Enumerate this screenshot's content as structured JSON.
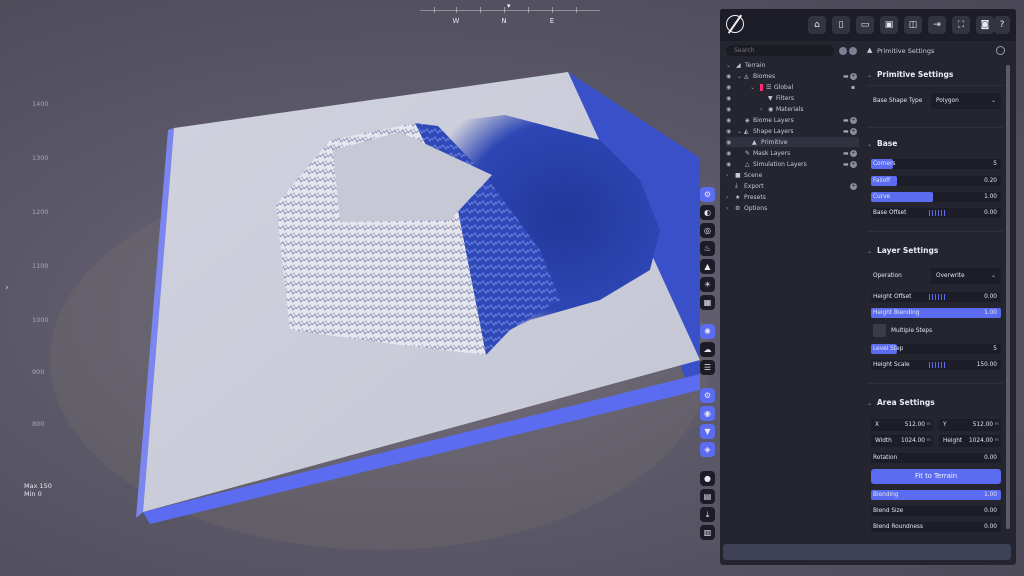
{
  "viewport": {
    "compass": [
      "W",
      "N",
      "E"
    ],
    "height_scale": [
      "1400",
      "1300",
      "1200",
      "1100",
      "1000",
      "900",
      "800"
    ],
    "height_readout": {
      "max": "Max 150",
      "min": "Min 0"
    },
    "tool_groups": [
      [
        "gear-icon",
        "circle-half-icon",
        "target-icon",
        "fire-icon",
        "triangle-icon",
        "sunrise-icon",
        "grid-icon"
      ],
      [
        "sparkle-icon",
        "cloud-icon",
        "lines-icon"
      ],
      [
        "settings-plus-icon",
        "eye-icon",
        "filter-icon",
        "layers-icon"
      ],
      [
        "record-icon",
        "folder-icon",
        "download-icon",
        "chart-icon"
      ]
    ],
    "colors": {
      "terrain_top": "#c9cbd8",
      "terrain_edge": "#5b6cf0",
      "shadow": "#2d42a8",
      "sky": "#5b5868"
    }
  },
  "toolbar": {
    "buttons": [
      "home-icon",
      "new-file-icon",
      "open-folder-icon",
      "save-icon",
      "save-as-icon",
      "export-icon",
      "fullscreen-icon",
      "camera-icon",
      "help-icon"
    ]
  },
  "tree": {
    "search_placeholder": "Search",
    "items": [
      {
        "label": "Terrain",
        "icon": "◢"
      },
      {
        "label": "Biomes",
        "icon": "◬"
      },
      {
        "label": "Global",
        "icon": "☰"
      },
      {
        "label": "Filters",
        "icon": "▼"
      },
      {
        "label": "Materials",
        "icon": "◉"
      },
      {
        "label": "Biome Layers",
        "icon": "◈"
      },
      {
        "label": "Shape Layers",
        "icon": "◭"
      },
      {
        "label": "Primitive",
        "icon": "▲"
      },
      {
        "label": "Mask Layers",
        "icon": "✎"
      },
      {
        "label": "Simulation Layers",
        "icon": "△"
      },
      {
        "label": "Scene",
        "icon": "■"
      },
      {
        "label": "Export",
        "icon": "⤓"
      },
      {
        "label": "Presets",
        "icon": "★"
      },
      {
        "label": "Options",
        "icon": "⚙"
      }
    ]
  },
  "settings": {
    "header": "Primitive Settings",
    "primitive_section": "Primitive Settings",
    "base_shape_type": {
      "label": "Base Shape Type",
      "value": "Polygon"
    },
    "base_section": "Base",
    "corners": {
      "label": "Corners",
      "value": "5",
      "fraction": 0.17
    },
    "falloff": {
      "label": "Falloff",
      "value": "0.20",
      "fraction": 0.2
    },
    "curve": {
      "label": "Curve",
      "value": "1.00",
      "fraction": 0.48
    },
    "base_offset": {
      "label": "Base Offset",
      "value": "0.00"
    },
    "layer_section": "Layer Settings",
    "operation": {
      "label": "Operation",
      "value": "Overwrite"
    },
    "height_offset": {
      "label": "Height Offset",
      "value": "0.00"
    },
    "height_blending": {
      "label": "Height Blending",
      "value": "1.00",
      "fraction": 1.0
    },
    "multiple_steps": {
      "label": "Multiple Steps"
    },
    "level_step": {
      "label": "Level Step",
      "value": "5",
      "fraction": 0.2
    },
    "height_scale": {
      "label": "Height Scale",
      "value": "150.00"
    },
    "area_section": "Area Settings",
    "x": {
      "label": "X",
      "value": "512.00",
      "unit": "m"
    },
    "y": {
      "label": "Y",
      "value": "512.00",
      "unit": "m"
    },
    "width": {
      "label": "Width",
      "value": "1024.00",
      "unit": "m"
    },
    "height": {
      "label": "Height",
      "value": "1024.00",
      "unit": "m"
    },
    "rotation": {
      "label": "Rotation",
      "value": "0.00"
    },
    "fit_button": "Fit to Terrain",
    "blending": {
      "label": "Blending",
      "value": "1.00",
      "fraction": 1.0
    },
    "blend_size": {
      "label": "Blend Size",
      "value": "0.00"
    },
    "blend_roundness": {
      "label": "Blend Roundness",
      "value": "0.00"
    }
  }
}
